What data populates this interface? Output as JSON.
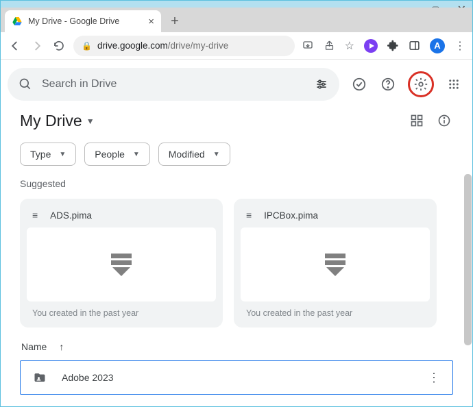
{
  "window": {
    "tab_title": "My Drive - Google Drive",
    "url_display": "drive.google.com/drive/my-drive",
    "url_host": "drive.google.com",
    "url_path": "/drive/my-drive",
    "avatar_letter": "A"
  },
  "search": {
    "placeholder": "Search in Drive"
  },
  "breadcrumb": {
    "title": "My Drive"
  },
  "chips": [
    {
      "label": "Type"
    },
    {
      "label": "People"
    },
    {
      "label": "Modified"
    }
  ],
  "suggested_label": "Suggested",
  "cards": [
    {
      "name": "ADS.pima",
      "footer": "You created in the past year"
    },
    {
      "name": "IPCBox.pima",
      "footer": "You created in the past year"
    }
  ],
  "list": {
    "header": "Name",
    "rows": [
      {
        "name": "Adobe 2023"
      }
    ]
  }
}
